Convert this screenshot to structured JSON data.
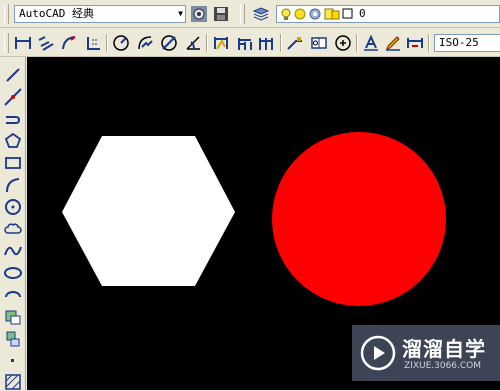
{
  "toolbar_top": {
    "workspace_value": "AutoCAD 经典",
    "layer_value": "0",
    "dimstyle_value": "ISO-25"
  },
  "watermark": {
    "title": "溜溜自学",
    "subtitle": "ZIXUE.3066.COM"
  },
  "canvas": {
    "background": "#000000",
    "shapes": [
      {
        "type": "hexagon",
        "fill": "#ffffff"
      },
      {
        "type": "circle",
        "fill": "#ff0000"
      }
    ]
  }
}
